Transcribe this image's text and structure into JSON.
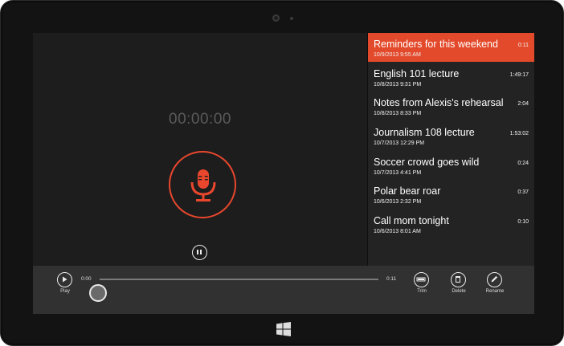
{
  "recorder": {
    "timer": "00:00:00",
    "record_icon": "microphone-icon",
    "pause_icon": "pause-icon"
  },
  "recordings": [
    {
      "title": "Reminders for this weekend",
      "date": "10/9/2013 9:55 AM",
      "duration": "0:11",
      "selected": true
    },
    {
      "title": "English 101 lecture",
      "date": "10/8/2013 9:31 PM",
      "duration": "1:49:17",
      "selected": false
    },
    {
      "title": "Notes from Alexis's rehearsal",
      "date": "10/8/2013 8:33 PM",
      "duration": "2:04",
      "selected": false
    },
    {
      "title": "Journalism 108 lecture",
      "date": "10/7/2013 12:29 PM",
      "duration": "1:53:02",
      "selected": false
    },
    {
      "title": "Soccer crowd goes wild",
      "date": "10/7/2013 4:41 PM",
      "duration": "0:24",
      "selected": false
    },
    {
      "title": "Polar bear roar",
      "date": "10/6/2013 2:32 PM",
      "duration": "0:37",
      "selected": false
    },
    {
      "title": "Call mom tonight",
      "date": "10/6/2013 8:01 AM",
      "duration": "0:10",
      "selected": false
    }
  ],
  "appbar": {
    "play_label": "Play",
    "time_start": "0:00",
    "time_end": "0:11",
    "playback_position": 0.0,
    "trim_label": "Trim",
    "delete_label": "Delete",
    "rename_label": "Rename"
  },
  "colors": {
    "accent": "#e34a2b",
    "background": "#1d1d1d",
    "list_background": "#232323",
    "appbar_background": "#313131"
  }
}
